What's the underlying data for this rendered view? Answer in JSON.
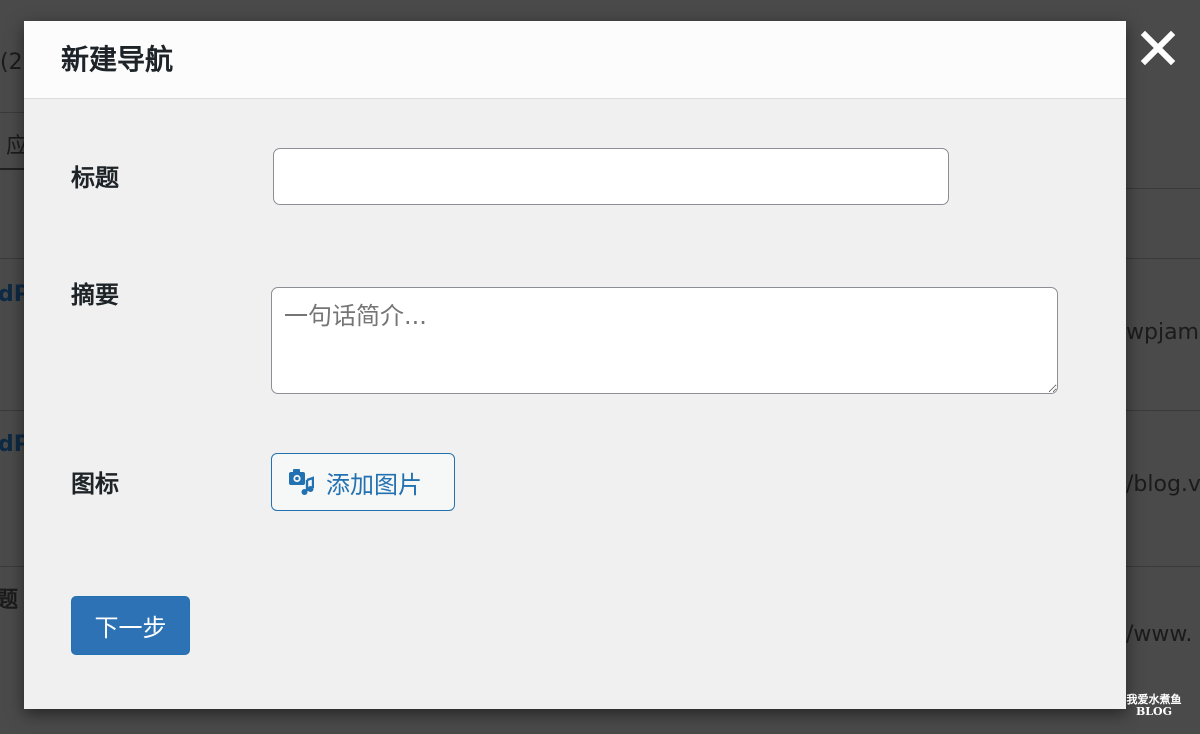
{
  "background": {
    "fragments": [
      "(2",
      "应",
      "dP",
      "dP",
      "题",
      "wpjam",
      "/blog.v",
      "/www."
    ]
  },
  "modal": {
    "title": "新建导航",
    "fields": {
      "title_label": "标题",
      "title_value": "",
      "summary_label": "摘要",
      "summary_placeholder": "一句话简介...",
      "icon_label": "图标",
      "add_image_label": "添加图片"
    },
    "next_button_label": "下一步"
  },
  "icons": {
    "close": "close-icon",
    "add_media": "add-media-icon"
  },
  "colors": {
    "accent": "#2271b1",
    "primary_button": "#2c72b5",
    "modal_body": "#f0f0f1",
    "modal_header": "#fcfcfc",
    "backdrop": "#4a4a4a"
  },
  "watermark": {
    "line1": "我爱水煮鱼",
    "line2": "BLOG"
  }
}
